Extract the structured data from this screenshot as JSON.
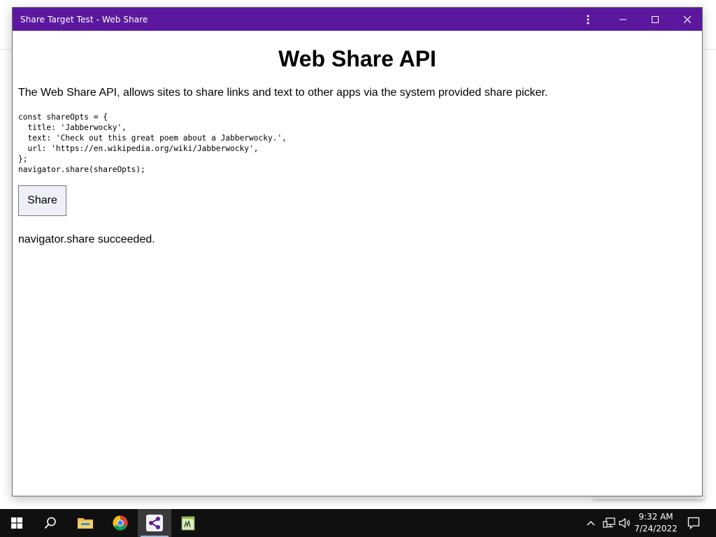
{
  "window": {
    "title": "Share Target Test - Web Share",
    "titlebar_color": "#5b189e"
  },
  "page": {
    "heading": "Web Share API",
    "description": "The Web Share API, allows sites to share links and text to other apps via the system provided share picker.",
    "code_lines": [
      "const shareOpts = {",
      "  title: 'Jabberwocky',",
      "  text: 'Check out this great poem about a Jabberwocky.',",
      "  url: 'https://en.wikipedia.org/wiki/Jabberwocky',",
      "};",
      "navigator.share(shareOpts);"
    ],
    "share_button_label": "Share",
    "status_text": "navigator.share succeeded."
  },
  "titlebar_controls": [
    "more-options-icon",
    "minimize-icon",
    "maximize-icon",
    "close-icon"
  ],
  "taskbar": {
    "items": [
      "windows-start-icon",
      "search-icon",
      "file-explorer-icon",
      "chrome-icon",
      "share-app-icon",
      "notepad-plus-plus-icon"
    ],
    "active_item": "share-app-icon",
    "tray": [
      "chevron-up-icon",
      "network-icon",
      "volume-icon"
    ],
    "time": "9:32 AM",
    "date": "7/24/2022",
    "notification_icon": "action-center-icon"
  }
}
